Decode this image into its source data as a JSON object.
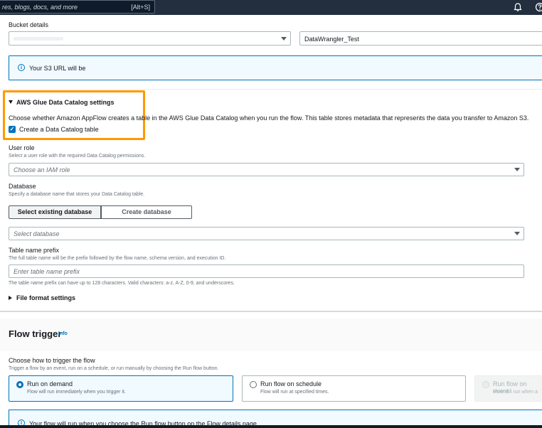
{
  "topbar": {
    "search_placeholder": "res, blogs, docs, and more",
    "search_shortcut": "[Alt+S]",
    "bell_icon": "bell-icon",
    "help_icon": "help-circle-icon"
  },
  "bucket": {
    "label": "Bucket details",
    "bucket_value_blurred": "",
    "prefix_value": "DataWrangler_Test",
    "s3_url_text": "Your S3 URL will be"
  },
  "glue": {
    "title": "AWS Glue Data Catalog settings",
    "description": "Choose whether Amazon AppFlow creates a table in the AWS Glue Data Catalog when you run the flow. This table stores metadata that represents the data you transfer to Amazon S3.",
    "checkbox_label": "Create a Data Catalog table",
    "checkbox_checked": true,
    "user_role": {
      "label": "User role",
      "hint": "Select a user role with the required Data Catalog permissions.",
      "placeholder": "Choose an IAM role"
    },
    "database": {
      "label": "Database",
      "hint": "Specify a database name that stores your Data Catalog table.",
      "tabs": [
        "Select existing database",
        "Create database"
      ],
      "selected_tab": "Select existing database",
      "placeholder": "Select database"
    },
    "table_prefix": {
      "label": "Table name prefix",
      "hint": "The full table name will be the prefix followed by the flow name, schema version, and execution ID.",
      "placeholder": "Enter table name prefix",
      "constraint": "The table name prefix can have up to 128 characters. Valid characters: a-z, A-Z, 0-9, and underscores."
    },
    "file_format": "File format settings"
  },
  "flow_trigger": {
    "title": "Flow trigger",
    "info_link": "Info",
    "choose_label": "Choose how to trigger the flow",
    "choose_hint": "Trigger a flow by an event, run on a schedule, or run manually by choosing the Run flow button.",
    "options": [
      {
        "label": "Run on demand",
        "desc": "Flow will run immediately when you trigger it.",
        "selected": true
      },
      {
        "label": "Run flow on schedule",
        "desc": "Flow will run at specified times.",
        "selected": false
      },
      {
        "label": "Run flow on event",
        "desc": "Flow will run when a",
        "disabled": true
      }
    ],
    "notice": "Your flow will run when you choose the Run flow button on the Flow details page."
  },
  "colors": {
    "highlight": "#ff9900",
    "accent": "#0073bb",
    "nav": "#232f3e"
  }
}
